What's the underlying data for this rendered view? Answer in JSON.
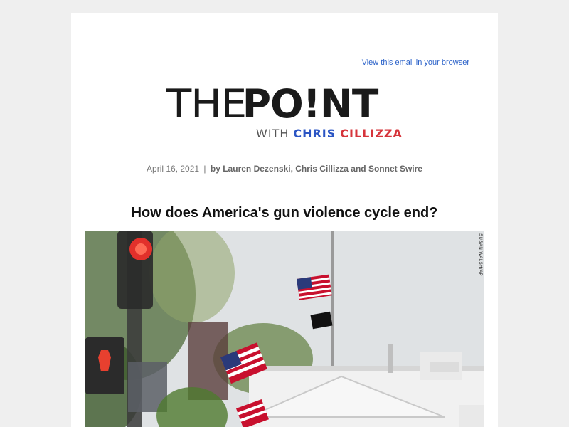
{
  "header": {
    "view_in_browser": "View this email in your browser"
  },
  "logo": {
    "the": "THE",
    "point": "PO!NT",
    "with": "WITH",
    "chris": "CHRIS",
    "cillizza": "CILLIZZA"
  },
  "byline": {
    "date": "April 16, 2021",
    "separator": "|",
    "authors": "by Lauren Dezenski, Chris Cillizza and Sonnet Swire"
  },
  "article": {
    "headline": "How does America's gun violence cycle end?",
    "photo_credit": "SUSAN WALSH/AP"
  },
  "colors": {
    "link": "#2b62c9",
    "chris_blue": "#2b55c4",
    "cillizza_red": "#d6343b"
  }
}
